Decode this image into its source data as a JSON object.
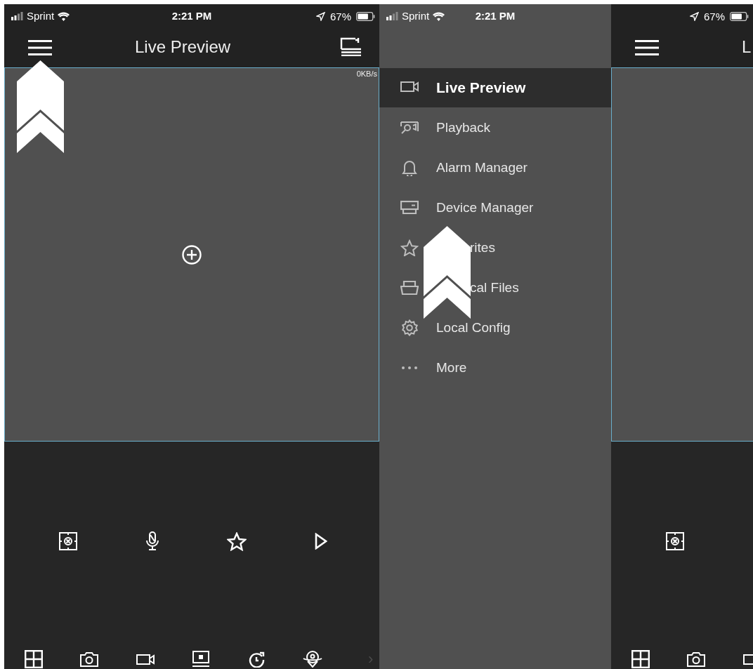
{
  "screens": [
    {
      "status_bar": {
        "carrier": "Sprint",
        "time": "2:21 PM",
        "battery": "67%"
      },
      "header": {
        "title": "Live Preview"
      },
      "video": {
        "rate": "0KB/s"
      },
      "controls": [
        {
          "kind": "ptz"
        },
        {
          "kind": "mic"
        },
        {
          "kind": "favorite"
        },
        {
          "kind": "play"
        }
      ],
      "toolbar": [
        {
          "kind": "layout"
        },
        {
          "kind": "snapshot"
        },
        {
          "kind": "record"
        },
        {
          "kind": "stream"
        },
        {
          "kind": "replay"
        },
        {
          "kind": "fisheye"
        }
      ],
      "toolbar_hint": "›"
    },
    {
      "drawer": {
        "status_bar": {
          "carrier": "Sprint",
          "time": "2:21 PM"
        },
        "items": [
          {
            "label": "Live Preview",
            "selected": true
          },
          {
            "label": "Playback",
            "selected": false
          },
          {
            "label": "Alarm Manager",
            "selected": false
          },
          {
            "label": "Device Manager",
            "selected": false
          },
          {
            "label": "rites",
            "selected": false,
            "covered": true
          },
          {
            "label": "cal Files",
            "selected": false,
            "covered": true
          },
          {
            "label": "Local Config",
            "selected": false
          },
          {
            "label": "More",
            "selected": false
          }
        ]
      },
      "status_bar": {
        "battery": "67%"
      },
      "header": {
        "title": "L"
      },
      "controls": [
        {
          "kind": "ptz"
        }
      ],
      "toolbar": [
        {
          "kind": "layout"
        },
        {
          "kind": "snapshot"
        },
        {
          "kind": "record"
        }
      ]
    }
  ]
}
